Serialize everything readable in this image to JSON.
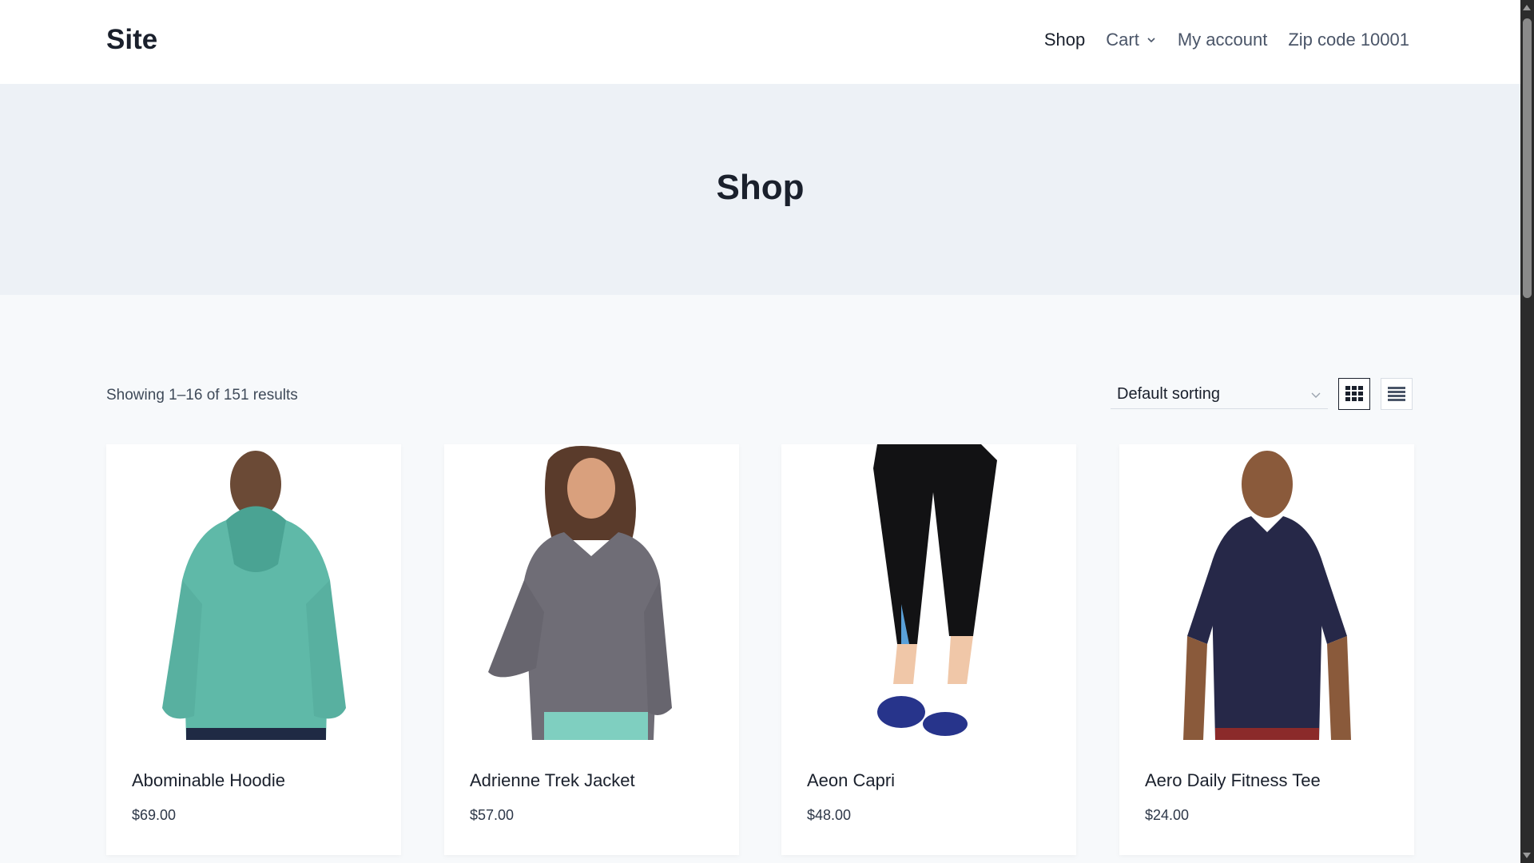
{
  "header": {
    "logo": "Site",
    "nav": [
      {
        "label": "Shop"
      },
      {
        "label": "Cart"
      },
      {
        "label": "My account"
      },
      {
        "label": "Zip code 10001"
      }
    ]
  },
  "hero": {
    "title": "Shop"
  },
  "toolbar": {
    "results_text": "Showing 1–16 of 151 results",
    "sort_selected": "Default sorting",
    "grid_view_icon": "grid-icon",
    "list_view_icon": "list-icon"
  },
  "products": [
    {
      "name": "Abominable Hoodie",
      "price": "$69.00",
      "image": "hoodie-photo"
    },
    {
      "name": "Adrienne Trek Jacket",
      "price": "$57.00",
      "image": "jacket-photo"
    },
    {
      "name": "Aeon Capri",
      "price": "$48.00",
      "image": "capri-photo"
    },
    {
      "name": "Aero Daily Fitness Tee",
      "price": "$24.00",
      "image": "tee-photo"
    }
  ],
  "colors": {
    "header_bg": "#ffffff",
    "hero_bg": "#edf1f6",
    "page_bg": "#f7f9fb",
    "text": "#1a202c"
  }
}
